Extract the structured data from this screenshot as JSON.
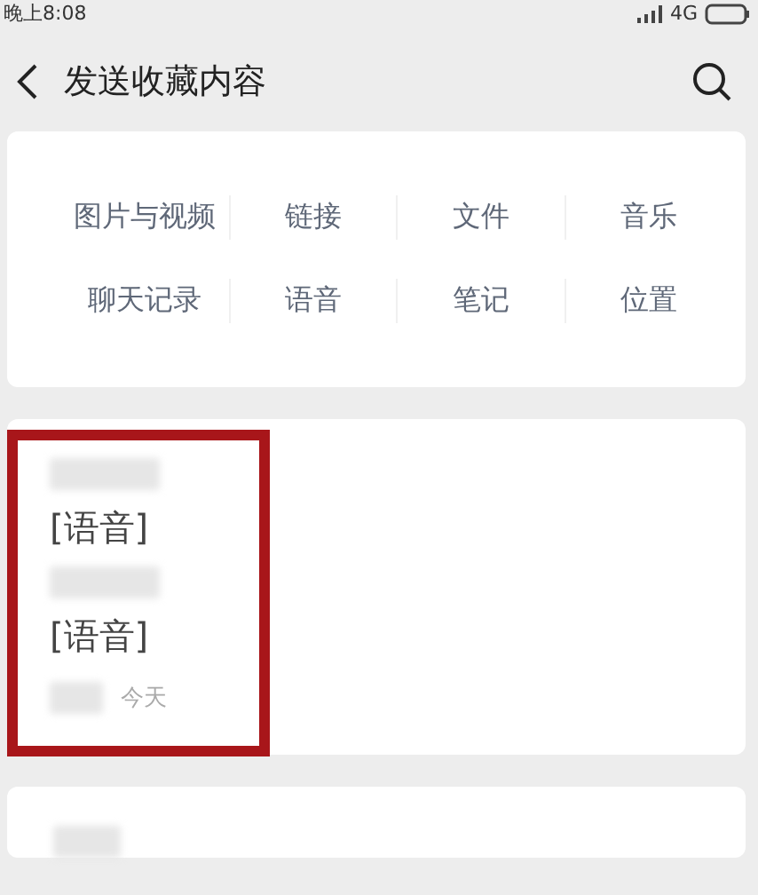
{
  "status_bar": {
    "time": "晚上8:08",
    "network": "4G"
  },
  "header": {
    "title": "发送收藏内容"
  },
  "categories": [
    "图片与视频",
    "链接",
    "文件",
    "音乐",
    "聊天记录",
    "语音",
    "笔记",
    "位置"
  ],
  "items": [
    {
      "kind": "voice",
      "highlighted": true,
      "lines": [
        "[语音]",
        "[语音]"
      ],
      "date": "今天"
    },
    {
      "kind": "redacted"
    }
  ]
}
